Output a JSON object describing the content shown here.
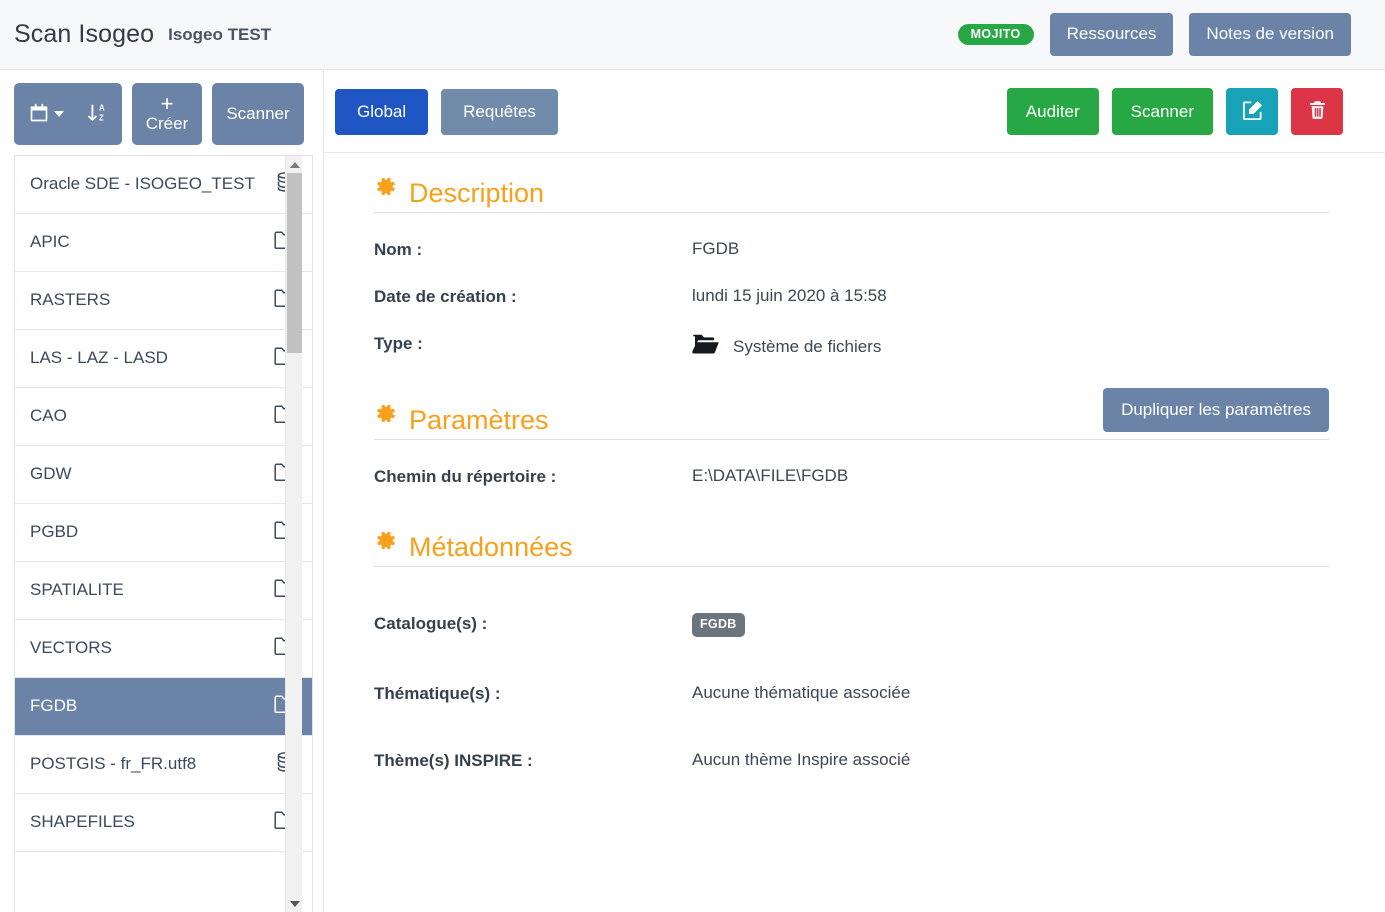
{
  "header": {
    "brand": "Scan Isogeo",
    "workgroup": "Isogeo TEST",
    "badge": "MOJITO",
    "resources_label": "Ressources",
    "release_notes_label": "Notes de version"
  },
  "sidebar": {
    "toolbar": {
      "calendar_icon": "calendar-icon",
      "caret_icon": "chevron-down-icon",
      "sort_icon": "sort-alpha-down-icon",
      "create_plus": "+",
      "create_label": "Créer",
      "scan_label": "Scanner"
    },
    "items": [
      {
        "label": "Oracle SDE - ISOGEO_TEST",
        "icon": "database-icon",
        "selected": false
      },
      {
        "label": "APIC",
        "icon": "folder-icon",
        "selected": false
      },
      {
        "label": "RASTERS",
        "icon": "folder-icon",
        "selected": false
      },
      {
        "label": "LAS - LAZ - LASD",
        "icon": "folder-icon",
        "selected": false
      },
      {
        "label": "CAO",
        "icon": "folder-icon",
        "selected": false
      },
      {
        "label": "GDW",
        "icon": "folder-icon",
        "selected": false
      },
      {
        "label": "PGBD",
        "icon": "folder-icon",
        "selected": false
      },
      {
        "label": "SPATIALITE",
        "icon": "folder-icon",
        "selected": false
      },
      {
        "label": "VECTORS",
        "icon": "folder-icon",
        "selected": false
      },
      {
        "label": "FGDB",
        "icon": "folder-icon",
        "selected": true
      },
      {
        "label": "POSTGIS - fr_FR.utf8",
        "icon": "database-icon",
        "selected": false
      },
      {
        "label": "SHAPEFILES",
        "icon": "folder-icon",
        "selected": false
      }
    ]
  },
  "main": {
    "tabs": [
      {
        "label": "Global",
        "active": true
      },
      {
        "label": "Requêtes",
        "active": false
      }
    ],
    "actions": {
      "audit_label": "Auditer",
      "scan_label": "Scanner",
      "edit_icon": "edit-pencil-square-icon",
      "delete_icon": "trash-icon"
    },
    "description": {
      "title": "Description",
      "rows": [
        {
          "label": "Nom :",
          "value": "FGDB"
        },
        {
          "label": "Date de création :",
          "value": "lundi 15 juin 2020 à 15:58"
        },
        {
          "label": "Type :",
          "value": "Système de fichiers",
          "icon": "open-folder-icon"
        }
      ]
    },
    "parametres": {
      "title": "Paramètres",
      "duplicate_label": "Dupliquer les paramètres",
      "rows": [
        {
          "label": "Chemin du répertoire :",
          "value": "E:\\DATA\\FILE\\FGDB"
        }
      ]
    },
    "metadonnees": {
      "title": "Métadonnées",
      "catalogue_label": "Catalogue(s) :",
      "catalogue_chip": "FGDB",
      "thematique_label": "Thématique(s) :",
      "thematique_value": "Aucune thématique associée",
      "inspire_label": "Thème(s) INSPIRE :",
      "inspire_value": "Aucun thème Inspire associé"
    }
  },
  "colors": {
    "slate": "#6c83a8",
    "primary_blue": "#1f56c4",
    "green": "#28a745",
    "teal": "#17a2b8",
    "red": "#dc3545",
    "orange": "#f7a01c",
    "grey_chip": "#6c757d"
  }
}
